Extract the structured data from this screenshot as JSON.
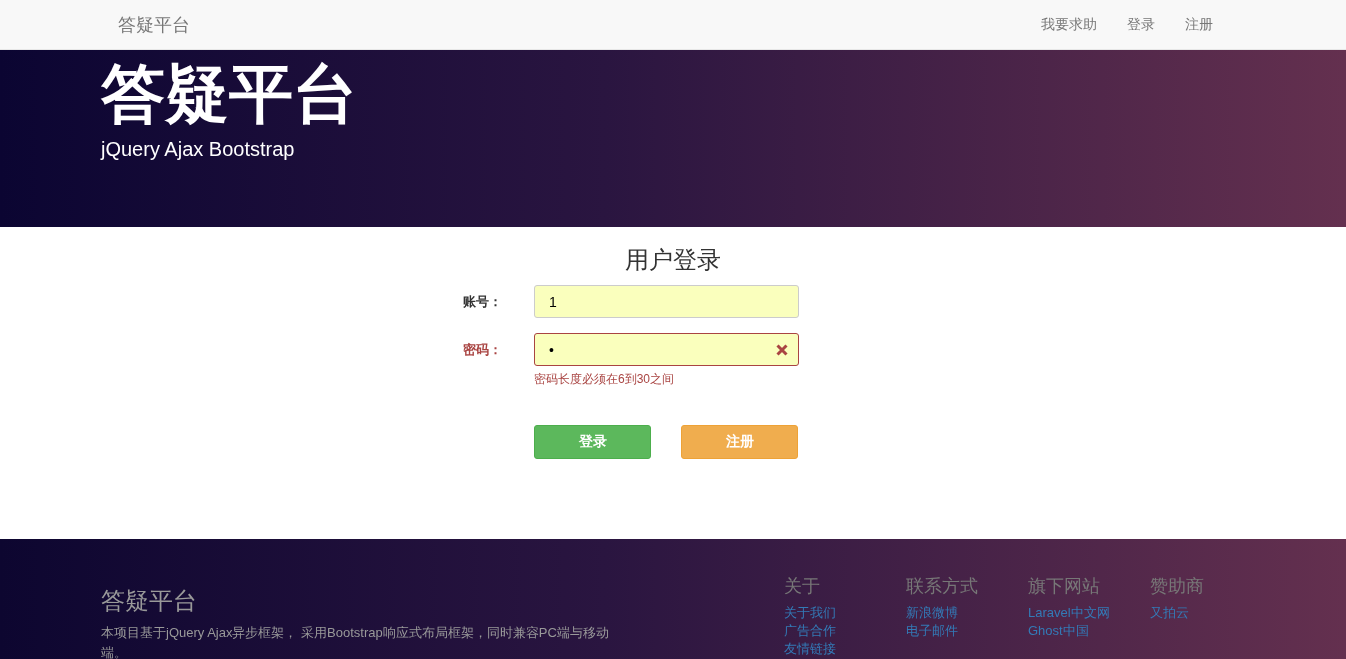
{
  "navbar": {
    "brand": "答疑平台",
    "links": [
      {
        "label": "我要求助"
      },
      {
        "label": "登录"
      },
      {
        "label": "注册"
      }
    ]
  },
  "hero": {
    "title": "答疑平台",
    "subtitle": "jQuery Ajax Bootstrap"
  },
  "login": {
    "title": "用户登录",
    "fields": [
      {
        "label": "账号：",
        "value": "1",
        "invalid": false
      },
      {
        "label": "密码：",
        "value": "•",
        "invalid": true,
        "help": "密码长度必须在6到30之间"
      }
    ],
    "buttons": [
      {
        "label": "登录",
        "kind": "success"
      },
      {
        "label": "注册",
        "kind": "warning"
      }
    ]
  },
  "footer": {
    "title": "答疑平台",
    "description": "本项目基于jQuery Ajax异步框架， 采用Bootstrap响应式布局框架，同时兼容PC端与移动端。",
    "columns": [
      {
        "heading": "关于",
        "links": [
          "关于我们",
          "广告合作",
          "友情链接"
        ]
      },
      {
        "heading": "联系方式",
        "links": [
          "新浪微博",
          "电子邮件"
        ]
      },
      {
        "heading": "旗下网站",
        "links": [
          "Laravel中文网",
          "Ghost中国"
        ]
      },
      {
        "heading": "赞助商",
        "links": [
          "又拍云"
        ]
      }
    ]
  }
}
